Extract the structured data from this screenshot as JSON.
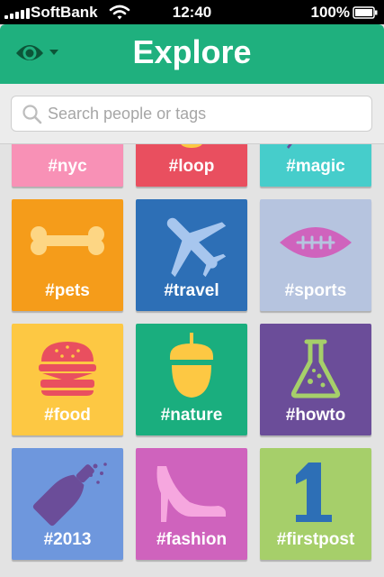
{
  "status_bar": {
    "carrier": "SoftBank",
    "time": "12:40",
    "battery": "100%"
  },
  "header": {
    "title": "Explore"
  },
  "search": {
    "placeholder": "Search people or tags"
  },
  "tiles": [
    {
      "tag": "#nyc",
      "color": "#f891b6",
      "icon": "nyc-icon"
    },
    {
      "tag": "#loop",
      "color": "#e94f5f",
      "icon": "loop-icon"
    },
    {
      "tag": "#magic",
      "color": "#46cdcb",
      "icon": "magic-icon"
    },
    {
      "tag": "#pets",
      "color": "#f59c1a",
      "icon": "bone-icon"
    },
    {
      "tag": "#travel",
      "color": "#2d6fb6",
      "icon": "airplane-icon"
    },
    {
      "tag": "#sports",
      "color": "#b6c4df",
      "icon": "football-icon"
    },
    {
      "tag": "#food",
      "color": "#fdc843",
      "icon": "burger-icon"
    },
    {
      "tag": "#nature",
      "color": "#1aae7e",
      "icon": "acorn-icon"
    },
    {
      "tag": "#howto",
      "color": "#6b4d99",
      "icon": "flask-icon"
    },
    {
      "tag": "#2013",
      "color": "#6e97dd",
      "icon": "champagne-icon"
    },
    {
      "tag": "#fashion",
      "color": "#cf63bd",
      "icon": "high-heel-icon"
    },
    {
      "tag": "#firstpost",
      "color": "#a6cf6a",
      "icon": "number-one-icon"
    }
  ]
}
